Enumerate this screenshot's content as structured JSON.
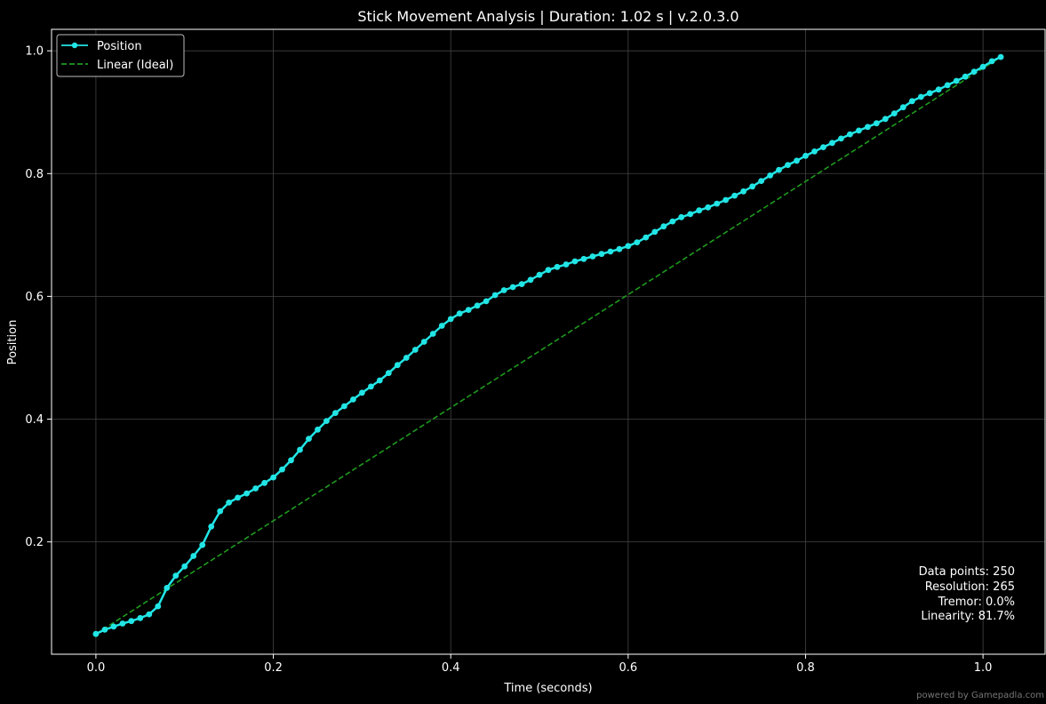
{
  "chart_data": {
    "type": "line",
    "title": "Stick Movement Analysis | Duration: 1.02 s | v.2.0.3.0",
    "xlabel": "Time (seconds)",
    "ylabel": "Position",
    "xlim": [
      -0.05,
      1.07
    ],
    "ylim": [
      0.017,
      1.035
    ],
    "xticks": [
      0.0,
      0.2,
      0.4,
      0.6,
      0.8,
      1.0
    ],
    "xtick_labels": [
      "0.0",
      "0.2",
      "0.4",
      "0.6",
      "0.8",
      "1.0"
    ],
    "yticks": [
      0.2,
      0.4,
      0.6,
      0.8,
      1.0
    ],
    "ytick_labels": [
      "0.2",
      "0.4",
      "0.6",
      "0.8",
      "1.0"
    ],
    "grid": true,
    "legend_position": "top-left",
    "colors": {
      "background": "#000000",
      "position": "#22e5e5",
      "linear": "#1f9a1f",
      "grid": "#444444",
      "text": "#ffffff"
    },
    "series": [
      {
        "name": "Position",
        "style": "line-with-markers",
        "x": [
          0.0,
          0.01,
          0.02,
          0.03,
          0.04,
          0.05,
          0.06,
          0.07,
          0.08,
          0.09,
          0.1,
          0.11,
          0.12,
          0.13,
          0.14,
          0.15,
          0.16,
          0.17,
          0.18,
          0.19,
          0.2,
          0.21,
          0.22,
          0.23,
          0.24,
          0.25,
          0.26,
          0.27,
          0.28,
          0.29,
          0.3,
          0.31,
          0.32,
          0.33,
          0.34,
          0.35,
          0.36,
          0.37,
          0.38,
          0.39,
          0.4,
          0.41,
          0.42,
          0.43,
          0.44,
          0.45,
          0.46,
          0.47,
          0.48,
          0.49,
          0.5,
          0.51,
          0.52,
          0.53,
          0.54,
          0.55,
          0.56,
          0.57,
          0.58,
          0.59,
          0.6,
          0.61,
          0.62,
          0.63,
          0.64,
          0.65,
          0.66,
          0.67,
          0.68,
          0.69,
          0.7,
          0.71,
          0.72,
          0.73,
          0.74,
          0.75,
          0.76,
          0.77,
          0.78,
          0.79,
          0.8,
          0.81,
          0.82,
          0.83,
          0.84,
          0.85,
          0.86,
          0.87,
          0.88,
          0.89,
          0.9,
          0.91,
          0.92,
          0.93,
          0.94,
          0.95,
          0.96,
          0.97,
          0.98,
          0.99,
          1.0,
          1.01,
          1.02
        ],
        "values": [
          0.05,
          0.057,
          0.062,
          0.067,
          0.071,
          0.076,
          0.082,
          0.095,
          0.125,
          0.145,
          0.16,
          0.177,
          0.195,
          0.225,
          0.25,
          0.264,
          0.272,
          0.279,
          0.287,
          0.296,
          0.305,
          0.318,
          0.333,
          0.35,
          0.368,
          0.383,
          0.397,
          0.41,
          0.421,
          0.432,
          0.443,
          0.453,
          0.463,
          0.475,
          0.488,
          0.5,
          0.513,
          0.526,
          0.539,
          0.552,
          0.563,
          0.572,
          0.578,
          0.585,
          0.592,
          0.602,
          0.61,
          0.615,
          0.62,
          0.627,
          0.635,
          0.643,
          0.648,
          0.652,
          0.657,
          0.661,
          0.665,
          0.669,
          0.673,
          0.677,
          0.682,
          0.688,
          0.696,
          0.705,
          0.714,
          0.722,
          0.729,
          0.734,
          0.74,
          0.745,
          0.751,
          0.757,
          0.764,
          0.771,
          0.779,
          0.788,
          0.797,
          0.806,
          0.814,
          0.821,
          0.829,
          0.836,
          0.843,
          0.85,
          0.857,
          0.864,
          0.87,
          0.876,
          0.882,
          0.889,
          0.898,
          0.908,
          0.918,
          0.925,
          0.931,
          0.937,
          0.944,
          0.951,
          0.958,
          0.966,
          0.974,
          0.983,
          0.99
        ]
      },
      {
        "name": "Linear (Ideal)",
        "style": "dashed",
        "x": [
          0.0,
          1.02
        ],
        "values": [
          0.05,
          0.99
        ]
      }
    ],
    "annotations": [
      "Data points: 250",
      "Resolution: 265",
      "Tremor: 0.0%",
      "Linearity: 81.7%"
    ]
  },
  "footer": {
    "credit": "powered by Gamepadla.com"
  }
}
